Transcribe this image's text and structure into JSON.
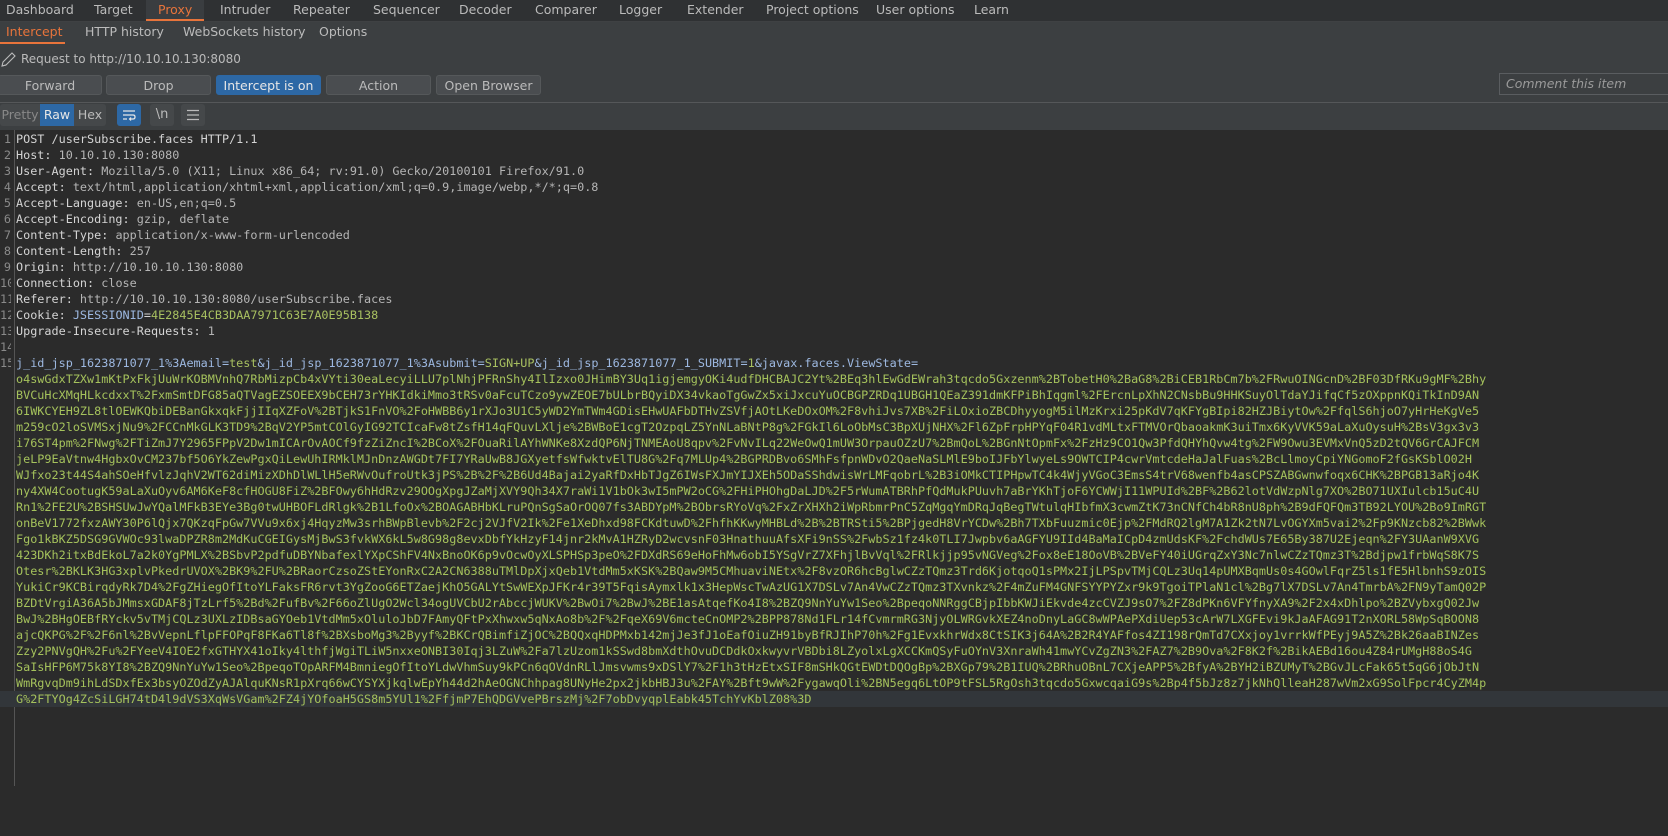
{
  "top_tabs": [
    {
      "label": "Dashboard",
      "active": false
    },
    {
      "label": "Target",
      "active": false
    },
    {
      "label": "Proxy",
      "active": true
    },
    {
      "label": "Intruder",
      "active": false
    },
    {
      "label": "Repeater",
      "active": false
    },
    {
      "label": "Sequencer",
      "active": false
    },
    {
      "label": "Decoder",
      "active": false
    },
    {
      "label": "Comparer",
      "active": false
    },
    {
      "label": "Logger",
      "active": false
    },
    {
      "label": "Extender",
      "active": false
    },
    {
      "label": "Project options",
      "active": false
    },
    {
      "label": "User options",
      "active": false
    },
    {
      "label": "Learn",
      "active": false
    }
  ],
  "sub_tabs": [
    {
      "label": "Intercept",
      "active": true
    },
    {
      "label": "HTTP history",
      "active": false
    },
    {
      "label": "WebSockets history",
      "active": false
    },
    {
      "label": "Options",
      "active": false
    }
  ],
  "intercept": {
    "request_label": "Request to http://10.10.10.130:8080",
    "buttons": {
      "forward": "Forward",
      "drop": "Drop",
      "intercept_toggle": "Intercept is on",
      "action": "Action",
      "open_browser": "Open Browser"
    },
    "comment_placeholder": "Comment this item"
  },
  "view_tabs": {
    "pretty": "Pretty",
    "raw": "Raw",
    "hex": "Hex",
    "selected": "Raw",
    "icons": [
      "wrap-lines-icon",
      "newline-icon",
      "menu-icon"
    ],
    "newline_label": "\\n"
  },
  "request": {
    "lines": [
      {
        "n": "1",
        "key": "POST /userSubscribe.faces HTTP/1.1",
        "val": ""
      },
      {
        "n": "2",
        "key": "Host: ",
        "val": "10.10.10.130:8080"
      },
      {
        "n": "3",
        "key": "User-Agent: ",
        "val": "Mozilla/5.0 (X11; Linux x86_64; rv:91.0) Gecko/20100101 Firefox/91.0"
      },
      {
        "n": "4",
        "key": "Accept: ",
        "val": "text/html,application/xhtml+xml,application/xml;q=0.9,image/webp,*/*;q=0.8"
      },
      {
        "n": "5",
        "key": "Accept-Language: ",
        "val": "en-US,en;q=0.5"
      },
      {
        "n": "6",
        "key": "Accept-Encoding: ",
        "val": "gzip, deflate"
      },
      {
        "n": "7",
        "key": "Content-Type: ",
        "val": "application/x-www-form-urlencoded"
      },
      {
        "n": "8",
        "key": "Content-Length: ",
        "val": "257"
      },
      {
        "n": "9",
        "key": "Origin: ",
        "val": "http://10.10.10.130:8080"
      },
      {
        "n": "10",
        "key": "Connection: ",
        "val": "close"
      },
      {
        "n": "11",
        "key": "Referer: ",
        "val": "http://10.10.10.130:8080/userSubscribe.faces"
      },
      {
        "n": "12",
        "key": "Cookie: ",
        "val": ""
      },
      {
        "n": "13",
        "key": "Upgrade-Insecure-Requests: ",
        "val": "1"
      },
      {
        "n": "14",
        "key": "",
        "val": ""
      }
    ],
    "cookie": {
      "name": "JSESSIONID",
      "eq": "=",
      "value": "4E2845E4CB3DAA7971C63E7A0E95B138"
    },
    "body": {
      "n": "15",
      "p1": "j_id_jsp_1623871077_1%3Aemail=",
      "v1": "test",
      "p2": "&j_id_jsp_1623871077_1%3Asubmit=",
      "v2": "SIGN+UP",
      "p3": "&j_id_jsp_1623871077_1_SUBMIT=",
      "v3": "1",
      "p4": "&javax.faces.ViewState=",
      "viewstate_lines": [
        "o4swGdxTZXw1mKtPxFkjUuWrKOBMVnhQ7RbMizpCb4xVYti30eaLecyiLLU7plNhjPFRnShy4IlIzxo0JHimBY3Uq1igjemgyOKi4udfDHCBAJC2Yt%2BEq3hlEwGdEWrah3tqcdo5Gxzenm%2BTobetH0%2BaG8%2BiCEB1RbCm7b%2FRwuOINGcnD%2BF03DfRKu9gMF%2Bhy",
        "BVCuHcXMqHLkcdxxT%2FxmSmtDFG85aQTVagEZSOEEX9bCEH73rYHKIdkiMmo3tRSv0aFcuTCzo9ywZEOE7bULbrBQyiDX34vkaoTgGwZx5xiJxcuYuOCBGPZRDq1UBGH1QEaZ391dmKFPiBhIqgml%2FErcnLpXhN2CNsbBu9HHKSuyOlTdaYJifqCf5zOXppnKQiTkInD9AN",
        "6IWKCYEH9ZL8tlOEWKQbiDEBanGkxqkFjjIIqXZFoV%2BTjkS1FnVO%2FoHWBB6y1rXJo3U1C5yWD2YmTWm4GDisEHwUAFbDTHvZSVfjAOtLKeDOxOM%2F8vhiJvs7XB%2FiLOxioZBCDhyyogM5ilMzKrxi25pKdV7qKFYgBIpi82HZJBiytOw%2FfqlS6hjoO7yHrHeKgVe5",
        "m259cO2loSVMSxjNu9%2FCCnMkGLK3TD9%2BqV2YP5mtCOlGyIG92TCIcaFw8tZsfH14qFQuvLXlje%2BWBoE1cgT2OzpqLZ5YnNLaBNtP8g%2FGkIl6LoObMsC3BpXUjNHX%2Fl6ZpFrpHPYqF04R1vdMLtxFTMVOrQbaoakmK3uiTmx6KyVVK59aLaXuOysuH%2BsV3gx3v3",
        "i76ST4pm%2FNwg%2FTiZmJ7Y2965FPpV2Dw1mICArOvAOCf9fzZiZncI%2BCoX%2FOuaRilAYhWNKe8XzdQP6NjTNMEAoU8qpv%2FvNvILq22WeOwQ1mUW3OrpauOZzU7%2BmQoL%2BGnNtOpmFx%2FzHz9CO1Qw3PfdQHYhQvw4tg%2FW9Owu3EVMxVnQ5zD2tQV6GrCAJFCM",
        "jeLP9EaVtnw4HgbxOvCM237bf5O6YkZewPgxQiLewUhIRMklMJnDnzAWGDt7FI7YRaUwB8JGXyetfsWfwktvElTU8G%2Fq7MLUp4%2BGPRDBvo6SMhFsfpnWDvO2QaeNaSLMlE9boIJFbYlwyeLs9OWTCIP4cwrVmtcdeHaJalFuas%2BcLlmoyCpiYNGomoF2fGsKSblO02H",
        "WJfxo23t44S4ahSOeHfvlzJqhV2WT62diMizXDhDlWLlH5eRWvOufroUtk3jPS%2B%2F%2B6Ud4Bajai2yaRfDxHbTJgZ6IWsFXJmYIJXEh5ODaSShdwisWrLMFqobrL%2B3iOMkCTIPHpwTC4k4WjyVGoC3EmsS4trV68wenfb4asCPSZABGwnwfoqx6CHK%2BPGB13aRjo4K",
        "ny4XW4CootugK59aLaXuOyv6AM6KeF8cfHOGU8FiZ%2BFOwy6hHdRzv29OOgXpgJZaMjXVY9Qh34X7raWi1V1bOk3wI5mPW2oCG%2FHiPHOhgDaLJD%2F5rWumATBRhPfQdMukPUuvh7aBrYKhTjoF6YCWWjI11WPUId%2BF%2B62lotVdWzpNlg7XO%2BO71UXIulcb15uC4U",
        "Rn1%2FE2U%2BSHSUwJwYQalMFkB3EYe3Bg0twUHBOFLdRlgk%2B1LfoOx%2BOAGABHbKLruPQnSgSaOrOQ07fs3ABDYpM%2BObrsRYoVq%2FxZrXHXh2iWpRbmrPnC5ZqMgqYmDRqJqBegTWtulqHIbfmX3cwmZtK73nCNfCh4bR8nU8ph%2B9dFQFQm3TB92LYOU%2Bo9ImRGT",
        "onBeV1772fxzAWY30P6lQjx7QKzqFpGw7VVu9x6xj4HqyzMw3srhBWpBlevb%2F2cj2VJfV2Ik%2Fe1XeDhxd98FCKdtuwD%2FhfhKKwyMHBLd%2B%2BTRSti5%2BPjgedH8VrYCDw%2Bh7TXbFuuzmic0Ejp%2FMdRQ2lgM7A1Zk2tN7LvOGYXm5vai2%2Fp9KNzcb82%2BWwk",
        "Fgo1kBKZ5DSG9GVWOc93lwaDPZR8m2MdKuCGEIGysMjBwS3fvkWX6kL5w8G98g8evxDbfYkHzyF14jnr2kMvA1HZRyD2wcvsnF03HnathuuAfsXFi9nSS%2FwbSz1fz4k0TLI7Jwpbv6aAGFYU9IId4BaMaICpD4zmUdsKF%2FchdWUs7E65By387U2Ejeqn%2FY3UAanW9XVG",
        "423DKh2itxBdEkoL7a2k0YgPMLX%2BSbvP2pdfuDBYNbafexlYXpCShFV4NxBnoOK6p9vOcwOyXLSPHSp3peO%2FDXdRS69eHoFhMw6obI5YSgVrZ7XFhjlBvVql%2FRlkjjp95vNGVeg%2Fox8eE18OoVB%2BVeFY40iUGrqZxY3Nc7nlwCZzTQmz3T%2Bdjpw1frbWqS8K7S",
        "Otesr%2BKLK3HG3xplvPkedrUVOX%2BK9%2FU%2BRaorCzsoZStEYonRxC2A2CN6388uTMlDpXjxQeb1VtdMm5xKSK%2BQaw9M5CMhuaviNEtx%2F8vzOR6hcBglwCZzTQmz3Trd6KjotqoQ1sPMx2IjLPSpvTMjCQLz3Uq14pUMXBqmUs0s4GOwlFqrZ5ls1fE5HlbnhS9zOIS",
        "YukiCr9KCBirqdyRk7D4%2FgZHiegOfItoYLFaksFR6rvt3YgZooG6ETZaejKhO5GALYtSwWEXpJFKr4r39T5FqisAymxlk1x3HepWscTwAzUG1X7DSLv7An4VwCZzTQmz3TXvnkz%2F4mZuFM4GNFSYYPYZxr9k9TgoiTPlaN1cl%2Bg7lX7DSLv7An4TmrbA%2FN9yTamQ02P",
        "BZDtVrgiA36A5bJMmsxGDAF8jTzLrf5%2Bd%2FufBv%2F66oZlUgO2Wcl34ogUVCbU2rAbccjWUKV%2BwOi7%2BwJ%2BE1asAtqefKo4I8%2BZQ9NnYuYw1Seo%2BpeqoNNRggCBjpIbbKWJiEkvde4zcCVZJ9sO7%2FZ8dPKn6VFYfnyXA9%2F2x4xDhlpo%2BZVybxgQ02Jw",
        "BwJ%2BHgOEBfRYckv5vTMjCQLz3UXLzIDBsaGYOeb1VtdMm5xOluloJbD7FAmyQFtPxXhwxw5qNxAo8b%2F%2FqeX69V6mcteCnOMP2%2BPP878Nd1FLr14fCvmrmRG3NjyOLWRGvkXEZ4noDnyLaGC8wWPAePXdiUep53cArW7LXGFEvi9kJaAFAG91T2nXORL58WpSqBOON8",
        "ajcQKPG%2F%2F6nl%2BvVepnLflpFFOPqF8FKa6Tl8f%2BXsboMg3%2Byyf%2BKCrQBimfiZjOC%2BQQxqHDPMxb142mjJe3fJ1oEafOiuZH91byBfRJIhP70h%2Fg1EvxkhrWdx8CtSIK3j64A%2B2R4YAFfos4ZI198rQmTd7CXxjoy1vrrkWfPEyj9A5Z%2Bk26aaBINZes",
        "Zzy2PNVgQH%2Fu%2FYeeV4IOE2fxGTHYX41oIky4lthfjWgiTLiW5nxxeONBI30Iqj3LZuW%2Fa7lzUzom1kSSwd8bmXdthOvuDCDdkOxkwyvrVBDbi8LZyolxLgXCCKmQSyFuOYnV3XnraWh41mwYCvZgZN3%2FAZ7%2B9Ova%2F8K2f%2BikAEBd16ou4Z84rUMgH88oS4G",
        "SaIsHFP6M75k8YI8%2BZQ9NnYuYw1Seo%2BpeqoTOpARFM4BmniegOfItoYLdwVhmSuy9kPCn6qOVdnRLlJmsvwms9xDSlY7%2F1h3tHzEtxSIF8mSHkQGtEWDtDQOgBp%2BXGp79%2B1IUQ%2BRhuOBnL7CXjeAPP5%2BfyA%2BYH2iBZUMyT%2BGvJLcFak65t5qG6jObJtN",
        "WmRgvqDm9ihLdSDxfEx3bsyOZOdZyAJAlquKNsR1pXrq66wCYSYXjkqlwEpYh44d2hAeOGNChhpag8UNyHe2px2jkbHBJ3u%2FAY%2Bft9wW%2FygawqOli%2BN5egq6LtOP9tFSL5RgOsh3tqcdo5GxwcqaiG9s%2Bp4f5bJz8z7jkNhQlleaH287wVm2xG9SolFpcr4CyZM4p",
        "G%2FTYOg4ZcSiLGH74tD4l9dVS3XqWsVGam%2FZ4jYOfoaH5GS8m5YUl1%2FfjmP7EhQDGVvePBrszMj%2F7obDvyqplEabk45TchYvKblZ08%3D"
      ]
    }
  }
}
